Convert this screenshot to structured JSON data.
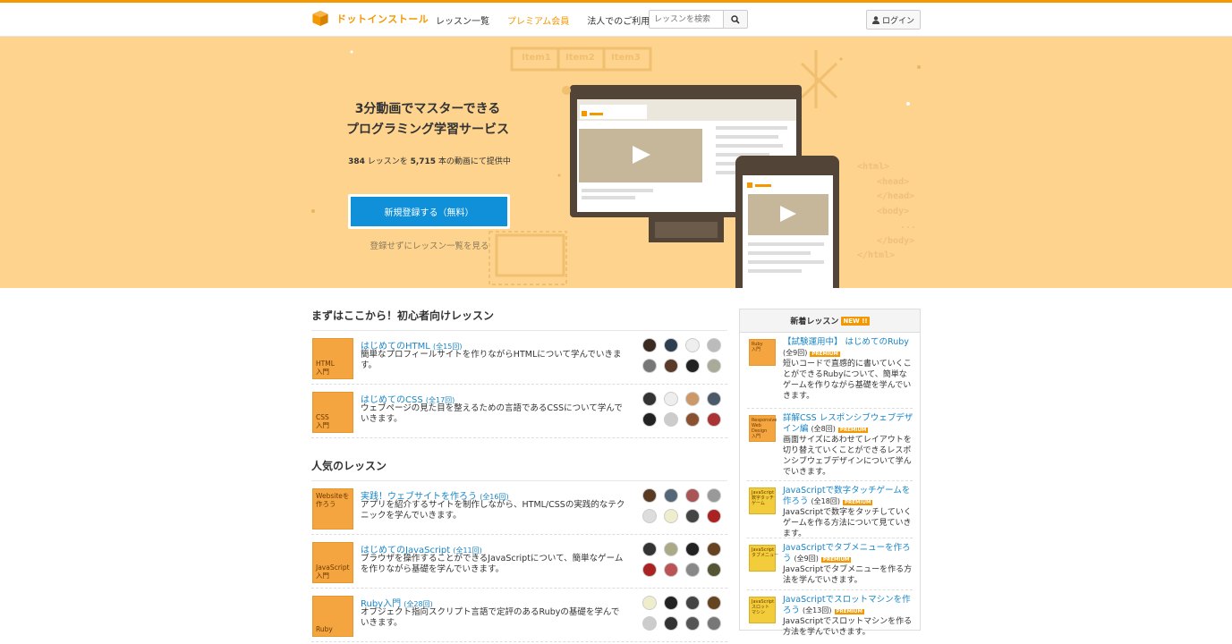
{
  "header": {
    "logo_text": "ドットインストール",
    "nav": [
      {
        "label": "レッスン一覧"
      },
      {
        "label": "プレミアム会員"
      },
      {
        "label": "法人でのご利用"
      }
    ],
    "search_placeholder": "レッスンを検索",
    "login_label": "ログイン"
  },
  "hero": {
    "title_line1": "3分動画でマスターできる",
    "title_line2": "プログラミング学習サービス",
    "count_lessons": "384",
    "count_text1": " レッスンを ",
    "count_videos": "5,715",
    "count_text2": " 本の動画にて提供中",
    "cta_label": "新規登録する（無料）",
    "cta_sub": "登録せずにレッスン一覧を見る",
    "ui_items": [
      "Item1",
      "Item2",
      "Item3"
    ],
    "code_lines": [
      "<html>",
      "<head>",
      "</head>",
      "<body>",
      "...",
      "</body>",
      "</html>"
    ]
  },
  "beginner": {
    "title": "まずはここから！初心者向けレッスン",
    "lessons": [
      {
        "thumb": "HTML\n入門",
        "title": "はじめてのHTML",
        "count": "(全15回)",
        "desc": "簡単なプロフィールサイトを作りながらHTMLについて学んでいきます。"
      },
      {
        "thumb": "CSS\n入門",
        "title": "はじめてのCSS",
        "count": "(全17回)",
        "desc": "ウェブページの見た目を整えるための言語であるCSSについて学んでいきます。"
      }
    ]
  },
  "popular": {
    "title": "人気のレッスン",
    "lessons": [
      {
        "thumb": "Websiteを\n作ろう",
        "title": "実践！ウェブサイトを作ろう",
        "count": "(全16回)",
        "desc": "アプリを紹介するサイトを制作しながら、HTML/CSSの実践的なテクニックを学んでいきます。"
      },
      {
        "thumb": "JavaScript\n入門",
        "title": "はじめてのJavaScript",
        "count": "(全11回)",
        "desc": "ブラウザを操作することができるJavaScriptについて、簡単なゲームを作りながら基礎を学んでいきます。"
      },
      {
        "thumb": "Ruby",
        "title": "Ruby入門",
        "count": "(全28回)",
        "desc": "オブジェクト指向スクリプト言語で定評のあるRubyの基礎を学んでいきます。"
      }
    ]
  },
  "sidebar": {
    "title": "新着レッスン",
    "badge": "NEW !!",
    "premium_label": "PREMIUM",
    "items": [
      {
        "thumb": "Ruby\n入門",
        "title": "【試験運用中】 はじめてのRuby",
        "count": "(全9回)",
        "desc": "短いコードで直感的に書いていくことができるRubyについて、簡単なゲームを作りながら基礎を学んでいきます。"
      },
      {
        "thumb": "Responsive\nWeb\nDesign\n入門",
        "title": "詳解CSS レスポンシブウェブデザイン編",
        "count": "(全8回)",
        "desc": "画面サイズにあわせてレイアウトを切り替えていくことができるレスポンシブウェブデザインについて学んでいきます。"
      },
      {
        "thumb": "JavaScript\n数字タッチ\nゲーム",
        "title": "JavaScriptで数字タッチゲームを作ろう",
        "count": "(全18回)",
        "desc": "JavaScriptで数字をタッチしていくゲームを作る方法について見ていきます。"
      },
      {
        "thumb": "JavaScript\nタブメニュー",
        "title": "JavaScriptでタブメニューを作ろう",
        "count": "(全9回)",
        "desc": "JavaScriptでタブメニューを作る方法を学んでいきます。"
      },
      {
        "thumb": "JavaScript\nスロット\nマシン",
        "title": "JavaScriptでスロットマシンを作ろう",
        "count": "(全13回)",
        "desc": "JavaScriptでスロットマシンを作る方法を学んでいきます。"
      }
    ]
  },
  "colors": {
    "brand": "#f39800",
    "hero_bg": "#fdd38e",
    "cta": "#0f90d8",
    "link": "#1a86c8"
  }
}
